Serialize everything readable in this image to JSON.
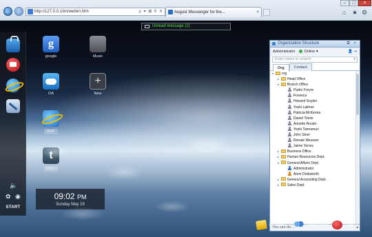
{
  "browser": {
    "address": "http://127.0.0.1/im/webim.htm",
    "address_tools": "ρ ▾ ⊠ ¢ ✕",
    "tab_title": "August Messenger for the...",
    "tab_close": "×",
    "back_glyph": "←",
    "forward_glyph": "→",
    "home_glyph": "⌂",
    "fav_glyph": "★",
    "settings_glyph": "⚙",
    "min_glyph": "–",
    "max_glyph": "□",
    "close_glyph": "×"
  },
  "notification": {
    "text": "Unread message (2)"
  },
  "dock": {
    "apps": [
      {
        "name": "bag-icon"
      },
      {
        "name": "messenger-icon"
      },
      {
        "name": "ie-icon"
      },
      {
        "name": "tools-icon"
      }
    ],
    "volume_glyph": "🔈",
    "gear_glyph": "✿",
    "globe_glyph": "◉",
    "start_label": "START"
  },
  "desktop_icons": [
    {
      "label": "google",
      "glyph": "g"
    },
    {
      "label": "Music",
      "glyph": ""
    },
    {
      "label": "OA",
      "glyph": ""
    },
    {
      "label": "New",
      "glyph": "+"
    },
    {
      "label": "ERP",
      "glyph": ""
    },
    {
      "label": "RDC",
      "glyph": "t"
    }
  ],
  "clock": {
    "time": "09:02",
    "ampm": "PM",
    "date": "Sunday May 19"
  },
  "org_panel": {
    "title": "Organization Structure",
    "title_tools": "⧉ ×",
    "user": "Administrator",
    "status": "Online ▾",
    "status_tools": "👤 ⇥",
    "search_placeholder": "Enter name to search",
    "search_arrow": "▾",
    "tabs": [
      "Org",
      "Contact"
    ],
    "tree": [
      {
        "label": "org",
        "type": "folder",
        "toggle": "▾",
        "indent": 0
      },
      {
        "label": "Head Office",
        "type": "folder",
        "toggle": "▸",
        "indent": 1
      },
      {
        "label": "Branch Office",
        "type": "folder",
        "toggle": "▾",
        "indent": 1
      },
      {
        "label": "Padro Freyre",
        "type": "person",
        "toggle": "",
        "indent": 2
      },
      {
        "label": "Fonseca",
        "type": "person",
        "toggle": "",
        "indent": 2
      },
      {
        "label": "Howard Snyder",
        "type": "person",
        "toggle": "",
        "indent": 2
      },
      {
        "label": "Yoshi Latimer",
        "type": "person",
        "toggle": "",
        "indent": 2
      },
      {
        "label": "Patricia McKenna",
        "type": "person",
        "toggle": "",
        "indent": 2
      },
      {
        "label": "Daniel Tonini",
        "type": "person",
        "toggle": "",
        "indent": 2
      },
      {
        "label": "Annette Roulet",
        "type": "person",
        "toggle": "",
        "indent": 2
      },
      {
        "label": "Yoshi Tannamuri",
        "type": "person",
        "toggle": "",
        "indent": 2
      },
      {
        "label": "John Steel",
        "type": "person",
        "toggle": "",
        "indent": 2
      },
      {
        "label": "Renate Messner",
        "type": "person",
        "toggle": "",
        "indent": 2
      },
      {
        "label": "Jaime Yorres",
        "type": "person",
        "toggle": "",
        "indent": 2
      },
      {
        "label": "Business Office",
        "type": "folder",
        "toggle": "▸",
        "indent": 1
      },
      {
        "label": "Human Resources Dept.",
        "type": "folder",
        "toggle": "▸",
        "indent": 1
      },
      {
        "label": "General Affairs Dept.",
        "type": "folder",
        "toggle": "▾",
        "indent": 1
      },
      {
        "label": "Administrator",
        "type": "person-admin",
        "toggle": "",
        "indent": 2
      },
      {
        "label": "Anne Dodsworth",
        "type": "person-anne",
        "toggle": "",
        "indent": 2
      },
      {
        "label": "General Accounting Dept.",
        "type": "folder",
        "toggle": "▸",
        "indent": 1
      },
      {
        "label": "Sales Dept.",
        "type": "folder",
        "toggle": "▸",
        "indent": 1
      }
    ],
    "footer": "You can do...",
    "footer_arrow": "▴"
  },
  "tray": [
    {
      "label": "My notes"
    },
    {
      "label": "Online users"
    },
    {
      "label": "Chat"
    }
  ]
}
